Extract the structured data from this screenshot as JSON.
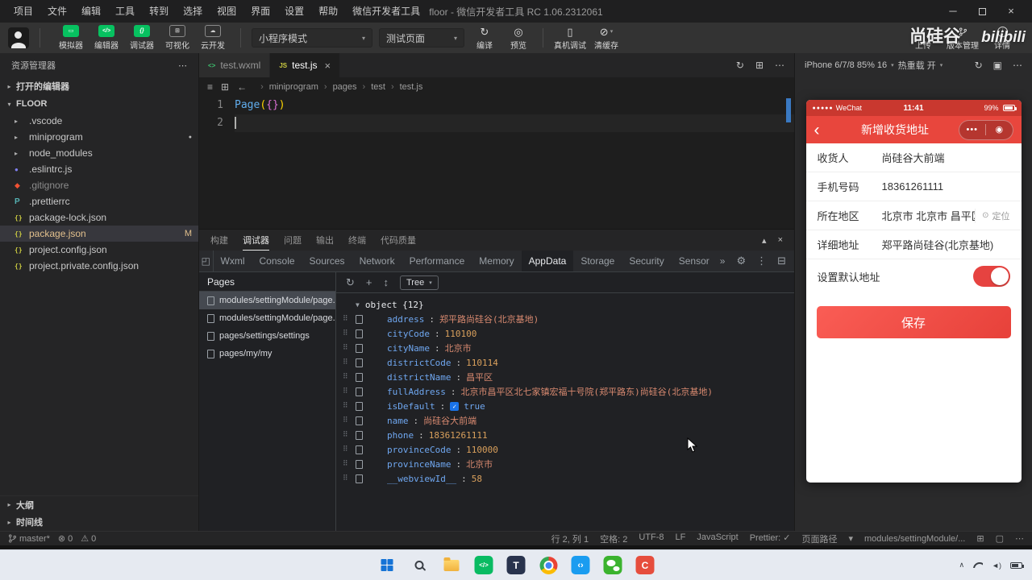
{
  "window": {
    "title": "floor - 微信开发者工具 RC 1.06.2312061"
  },
  "menubar": {
    "items": [
      "项目",
      "文件",
      "编辑",
      "工具",
      "转到",
      "选择",
      "视图",
      "界面",
      "设置",
      "帮助",
      "微信开发者工具"
    ]
  },
  "toolbar": {
    "panels": [
      {
        "label": "模拟器",
        "glyph": "▭",
        "on": true
      },
      {
        "label": "编辑器",
        "glyph": "</>",
        "on": true
      },
      {
        "label": "调试器",
        "glyph": "{}",
        "on": true
      },
      {
        "label": "可视化",
        "glyph": "⊞",
        "on": false
      },
      {
        "label": "云开发",
        "glyph": "☁",
        "on": false
      }
    ],
    "mode_select": "小程序模式",
    "page_select": "测试页面",
    "compile": "编译",
    "preview": "预览",
    "remote_debug": "真机调试",
    "clear_cache": "清缓存",
    "upload": "上传",
    "version": "版本管理",
    "details": "详情",
    "watermark": {
      "brand": "尚硅谷",
      "site": "bilibili"
    }
  },
  "sidebar": {
    "title": "资源管理器",
    "open_editors": "打开的编辑器",
    "project": "FLOOR",
    "files": [
      {
        "name": ".vscode",
        "kind": "folder",
        "lead": "▸"
      },
      {
        "name": "miniprogram",
        "kind": "folder",
        "lead": "▸",
        "badge": "●",
        "badge_cls": "dot"
      },
      {
        "name": "node_modules",
        "kind": "folder",
        "lead": "▸"
      },
      {
        "name": ".eslintrc.js",
        "kind": "eslint",
        "lead": "●"
      },
      {
        "name": ".gitignore",
        "kind": "git",
        "lead": "◆",
        "dim": true
      },
      {
        "name": ".prettierrc",
        "kind": "prettier",
        "lead": "P"
      },
      {
        "name": "package-lock.json",
        "kind": "json",
        "lead": "{}"
      },
      {
        "name": "package.json",
        "kind": "json",
        "lead": "{}",
        "selected": true,
        "mod": true,
        "badge": "M",
        "badge_cls": "mod"
      },
      {
        "name": "project.config.json",
        "kind": "json",
        "lead": "{}"
      },
      {
        "name": "project.private.config.json",
        "kind": "json",
        "lead": "{}"
      }
    ],
    "outline": "大纲",
    "timeline": "时间线"
  },
  "editor": {
    "tabs": [
      {
        "name": "test.wxml",
        "icon": "wxml",
        "icon_glyph": "<>"
      },
      {
        "name": "test.js",
        "icon": "js",
        "icon_glyph": "JS",
        "active": true
      }
    ],
    "breadcrumb": [
      {
        "t": "miniprogram"
      },
      {
        "t": "pages"
      },
      {
        "t": "test"
      },
      {
        "t": "test.js"
      }
    ],
    "line_numbers": [
      "1",
      "2"
    ],
    "code_tokens": [
      {
        "t": "Page",
        "c": "fn"
      },
      {
        "t": "(",
        "c": "b1"
      },
      {
        "t": "{}",
        "c": "b2"
      },
      {
        "t": ")",
        "c": "b1"
      }
    ]
  },
  "debugger": {
    "panel_tabs": [
      {
        "label": "构建"
      },
      {
        "label": "调试器",
        "active": true
      },
      {
        "label": "问题"
      },
      {
        "label": "输出"
      },
      {
        "label": "终端"
      },
      {
        "label": "代码质量"
      }
    ],
    "devtools_tabs": [
      {
        "label": "Wxml"
      },
      {
        "label": "Console"
      },
      {
        "label": "Sources"
      },
      {
        "label": "Network"
      },
      {
        "label": "Performance"
      },
      {
        "label": "Memory"
      },
      {
        "label": "AppData",
        "active": true
      },
      {
        "label": "Storage"
      },
      {
        "label": "Security"
      },
      {
        "label": "Sensor"
      }
    ],
    "pages": {
      "header": "Pages",
      "items": [
        {
          "path": "modules/settingModule/page...",
          "selected": true
        },
        {
          "path": "modules/settingModule/page..."
        },
        {
          "path": "pages/settings/settings"
        },
        {
          "path": "pages/my/my"
        }
      ]
    },
    "tree": {
      "view_select": "Tree",
      "root": "object {12}",
      "items": [
        {
          "key": "address",
          "value": "郑平路尚硅谷(北京基地)",
          "type": "string"
        },
        {
          "key": "cityCode",
          "value": "110100",
          "type": "number"
        },
        {
          "key": "cityName",
          "value": "北京市",
          "type": "string"
        },
        {
          "key": "districtCode",
          "value": "110114",
          "type": "number"
        },
        {
          "key": "districtName",
          "value": "昌平区",
          "type": "string"
        },
        {
          "key": "fullAddress",
          "value": "北京市昌平区北七家镇宏福十号院(郑平路东)尚硅谷(北京基地)",
          "type": "string"
        },
        {
          "key": "isDefault",
          "value": "true",
          "type": "boolean",
          "checkbox": true
        },
        {
          "key": "name",
          "value": "尚硅谷大前端",
          "type": "string"
        },
        {
          "key": "phone",
          "value": "18361261111",
          "type": "number"
        },
        {
          "key": "provinceCode",
          "value": "110000",
          "type": "number"
        },
        {
          "key": "provinceName",
          "value": "北京市",
          "type": "string"
        },
        {
          "key": "__webviewId__",
          "value": "58",
          "type": "number"
        }
      ]
    }
  },
  "simulator": {
    "device_label": "iPhone 6/7/8 85% 16",
    "hot_reload_label": "热重载 开",
    "phone": {
      "status_bar": {
        "signal_dots": "●●●●●",
        "carrier": "WeChat",
        "time": "11:41",
        "battery": "99%"
      },
      "nav": {
        "title": "新增收货地址"
      },
      "form": [
        {
          "label": "收货人",
          "value": "尚硅谷大前端"
        },
        {
          "label": "手机号码",
          "value": "18361261111"
        },
        {
          "label": "所在地区",
          "value": "北京市 北京市 昌平区",
          "extra": "定位"
        },
        {
          "label": "详细地址",
          "value": "郑平路尚硅谷(北京基地)"
        }
      ],
      "default_row": {
        "label": "设置默认地址",
        "on": true
      },
      "save_button": "保存"
    }
  },
  "statusbar": {
    "branch": "master*",
    "errors": "0",
    "warnings": "0",
    "right_items": [
      "行 2, 列 1",
      "空格: 2",
      "UTF-8",
      "LF",
      "JavaScript",
      "Prettier: ✓"
    ],
    "page_path_label": "页面路径",
    "page_path_value": "modules/settingModule/..."
  },
  "taskbar": {
    "icons": [
      "start",
      "search",
      "file-explorer",
      "wechat-devtools",
      "t-app",
      "chrome",
      "vscode",
      "wechat",
      "c-app"
    ]
  },
  "colors": {
    "wechat_red": "#e64340",
    "wechat_green": "#07c160",
    "devtools_key_blue": "#6fa7f0",
    "taskbar_bg": "#e6eaf1"
  }
}
